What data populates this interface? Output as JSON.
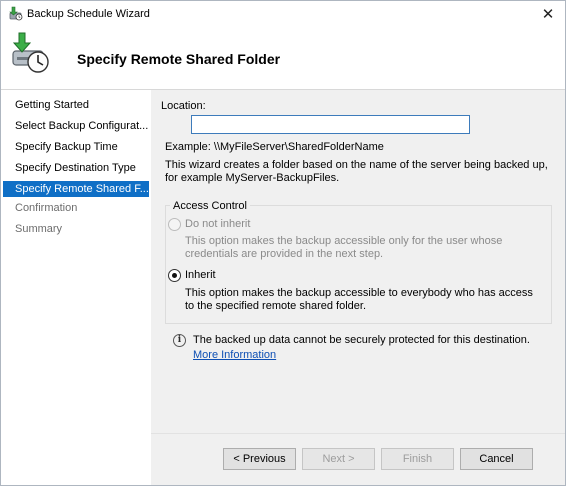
{
  "window": {
    "title": "Backup Schedule Wizard",
    "close_symbol": "✕"
  },
  "header": {
    "title": "Specify Remote Shared Folder",
    "icon": "backup-clock-icon"
  },
  "sidebar": {
    "items": [
      {
        "label": "Getting Started",
        "state": "normal"
      },
      {
        "label": "Select Backup Configurat...",
        "state": "normal"
      },
      {
        "label": "Specify Backup Time",
        "state": "normal"
      },
      {
        "label": "Specify Destination Type",
        "state": "normal"
      },
      {
        "label": "Specify Remote Shared F...",
        "state": "active"
      },
      {
        "label": "Confirmation",
        "state": "disabled"
      },
      {
        "label": "Summary",
        "state": "disabled"
      }
    ]
  },
  "content": {
    "location_label": "Location:",
    "location_value": "",
    "example": "Example: \\\\MyFileServer\\SharedFolderName",
    "description": "This wizard creates a folder based on the name of the server being backed up, for example MyServer-BackupFiles.",
    "access_control": {
      "legend": "Access Control",
      "options": [
        {
          "label": "Do not inherit",
          "description": "This option makes the backup accessible only for the user whose credentials are provided in the next step.",
          "selected": false,
          "enabled": false
        },
        {
          "label": "Inherit",
          "description": "This option makes the backup accessible to everybody who has access to the specified remote shared folder.",
          "selected": true,
          "enabled": true
        }
      ]
    },
    "info": {
      "text": "The backed up data cannot be securely protected for this destination.",
      "link": "More Information",
      "icon": "info-icon"
    }
  },
  "buttons": {
    "previous": "< Previous",
    "next": "Next >",
    "finish": "Finish",
    "cancel": "Cancel"
  },
  "colors": {
    "active_nav": "#0f6fc6",
    "link": "#0d4fb4"
  }
}
